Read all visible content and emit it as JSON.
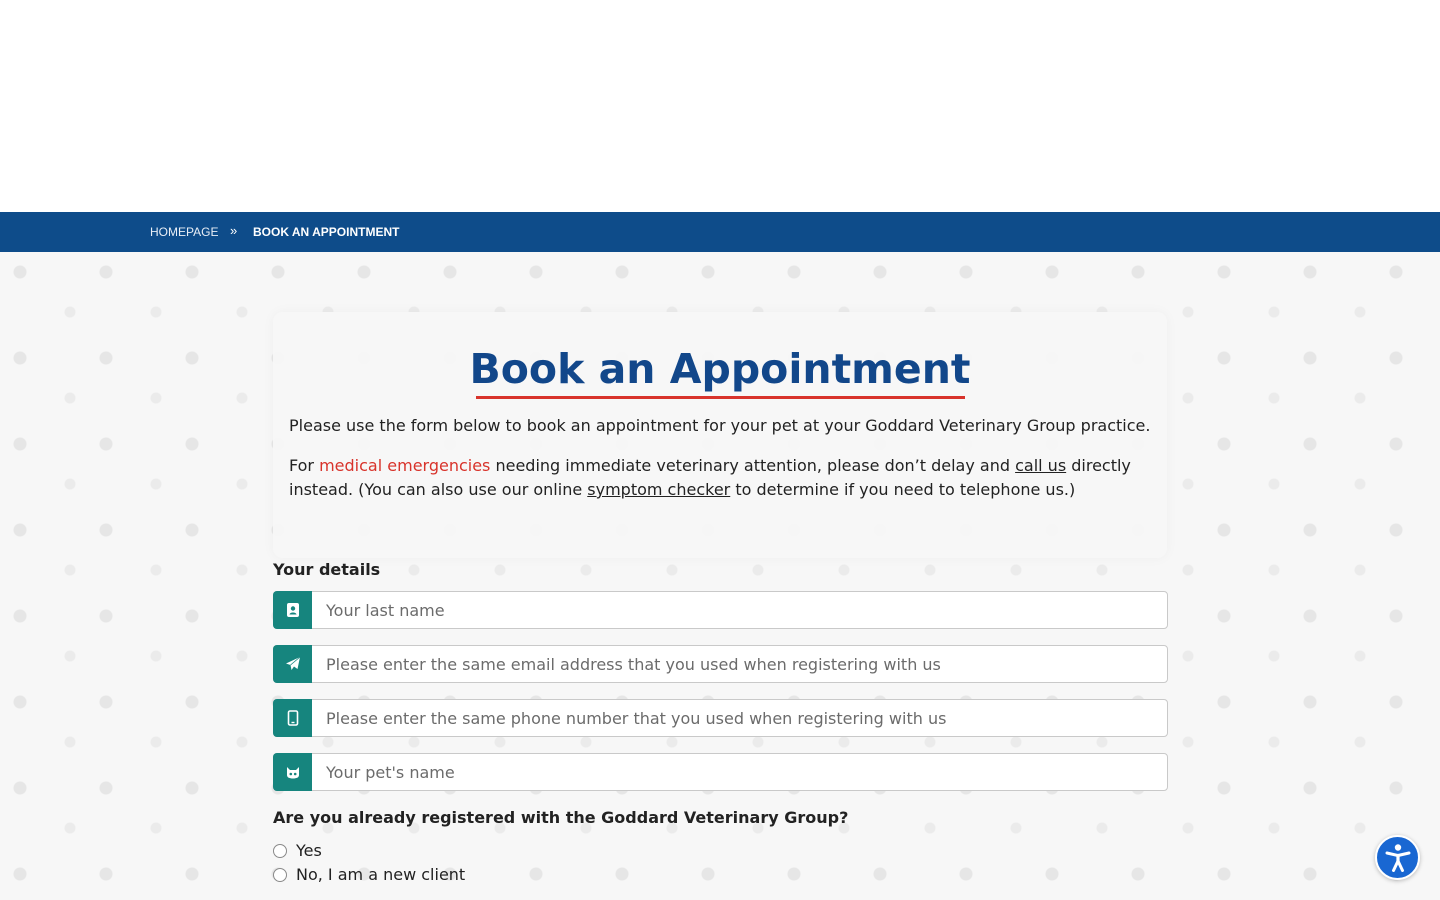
{
  "breadcrumb": {
    "home": "HOMEPAGE",
    "separator": "»",
    "current": "BOOK AN APPOINTMENT"
  },
  "intro": {
    "title": "Book an Appointment",
    "paragraph1": "Please use the form below to book an appointment for your pet at your Goddard Veterinary Group practice.",
    "p2_before": "For ",
    "p2_link_emergencies": "medical emergencies",
    "p2_middle": " needing immediate veterinary attention, please don’t delay and ",
    "p2_link_call": "call us",
    "p2_after_call": " directly instead. (You can also use our online ",
    "p2_link_symptom": "symptom checker",
    "p2_end": " to determine if you need to telephone us.)"
  },
  "form": {
    "section_label": "Your details",
    "fields": [
      {
        "placeholder": "Your last name",
        "icon": "id-card-icon"
      },
      {
        "placeholder": "Please enter the same email address that you used when registering with us",
        "icon": "paper-plane-icon"
      },
      {
        "placeholder": "Please enter the same phone number that you used when registering with us",
        "icon": "mobile-phone-icon"
      },
      {
        "placeholder": "Your pet's name",
        "icon": "cat-face-icon"
      }
    ],
    "question": "Are you already registered with the Goddard Veterinary Group?",
    "options": [
      "Yes",
      "No, I am a new client"
    ]
  },
  "colors": {
    "brand_blue": "#0e4c8a",
    "title_blue": "#12478a",
    "accent_red": "#d8332b",
    "addon_teal": "#16857e",
    "a11y_blue": "#1967d2"
  },
  "accessibility_button": {
    "icon": "accessibility-person-icon"
  }
}
